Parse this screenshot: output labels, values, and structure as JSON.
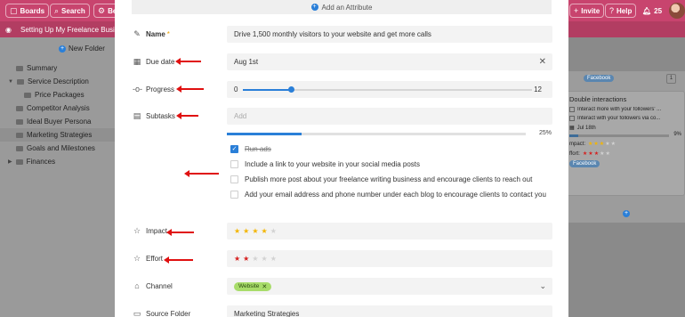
{
  "topbar": {
    "boards": "Boards",
    "search": "Search",
    "be": "Be",
    "invite": "Invite",
    "help": "Help",
    "notifications": "25"
  },
  "subbar": {
    "title": "Setting Up My Freelance Busi"
  },
  "sidebar": {
    "new_folder": "New Folder",
    "items": [
      {
        "label": "Summary"
      },
      {
        "label": "Service Description"
      },
      {
        "label": "Price Packages"
      },
      {
        "label": "Competitor Analysis"
      },
      {
        "label": "Ideal Buyer Persona"
      },
      {
        "label": "Marketing Strategies"
      },
      {
        "label": "Goals and Milestones"
      },
      {
        "label": "Finances"
      }
    ]
  },
  "right_panel": {
    "tag": "Facebook",
    "count": "1",
    "card": {
      "title": "Double interactions",
      "subtasks": [
        "Interact more with your followers' ...",
        "Interact with your followers via co..."
      ],
      "date": "Jul 18th",
      "progress_label": "9%",
      "progress": 0.09,
      "impact_label": "mpact:",
      "effort_label": "ffort:",
      "impact_stars": 3,
      "effort_stars": 3,
      "tag": "Facebook"
    }
  },
  "modal": {
    "add_attribute": "Add an Attribute",
    "name": {
      "label": "Name",
      "value": "Drive 1,500 monthly visitors to your website and get more calls"
    },
    "due_date": {
      "label": "Due date",
      "value": "Aug 1st"
    },
    "progress": {
      "label": "Progress",
      "min": "0",
      "max": "12",
      "value": 2,
      "max_value": 12
    },
    "subtasks": {
      "label": "Subtasks",
      "placeholder": "Add",
      "percent_label": "25%",
      "percent": 0.25,
      "items": [
        {
          "text": "Run ads",
          "done": true
        },
        {
          "text": "Include a link to your website in your social media posts",
          "done": false
        },
        {
          "text": "Publish more post about your freelance writing business and encourage clients to reach out",
          "done": false
        },
        {
          "text": "Add your email address and phone number under each blog to encourage clients to contact you",
          "done": false
        }
      ]
    },
    "impact": {
      "label": "Impact",
      "stars": 4,
      "max": 5
    },
    "effort": {
      "label": "Effort",
      "stars": 2,
      "max": 5
    },
    "channel": {
      "label": "Channel",
      "chip": "Website"
    },
    "source_folder": {
      "label": "Source Folder",
      "value": "Marketing Strategies"
    }
  }
}
